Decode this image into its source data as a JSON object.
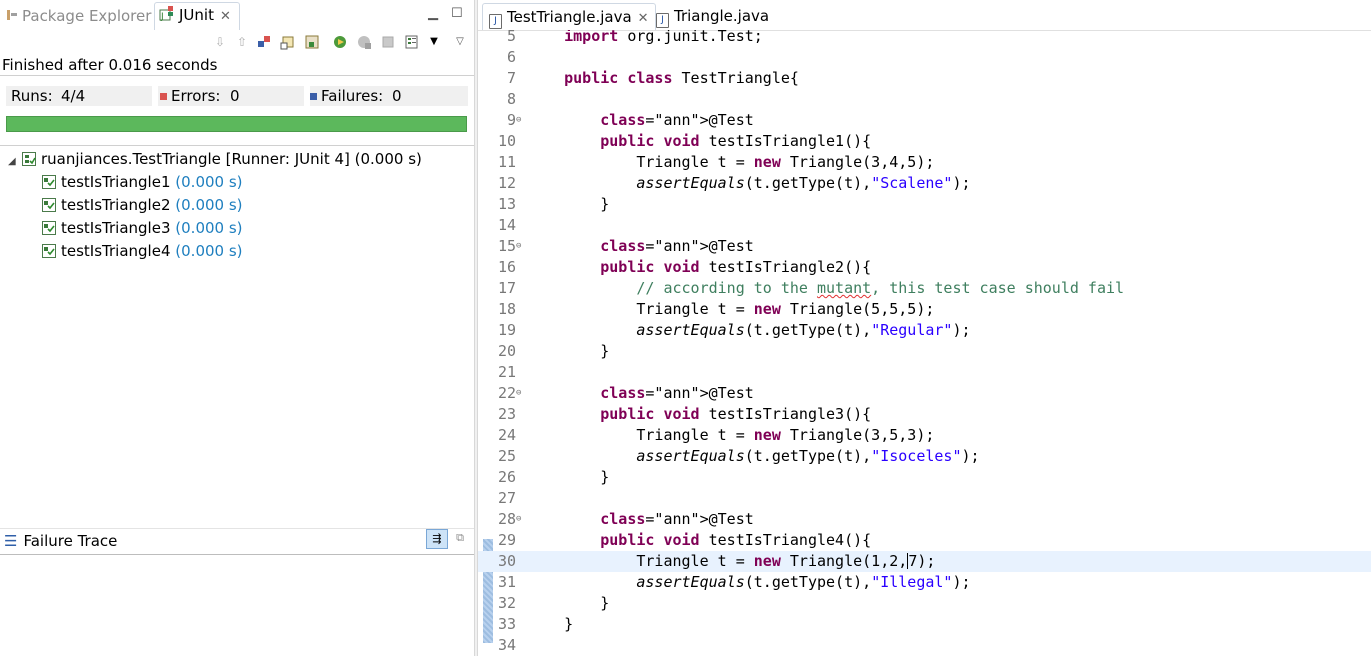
{
  "left_panel": {
    "tabs": {
      "package_explorer": "Package Explorer",
      "junit": "JUnit"
    },
    "toolbar_icons": [
      "next-failure-icon",
      "previous-failure-icon",
      "show-failures-only-icon",
      "scroll-lock-icon",
      "history-icon",
      "rerun-icon",
      "rerun-failed-first-icon",
      "stop-icon",
      "view-menu-icon",
      "dropdown-icon",
      "panel-menu-icon"
    ],
    "status": "Finished after 0.016 seconds",
    "counters": {
      "runs_label": "Runs:",
      "runs_value": "4/4",
      "errors_label": "Errors:",
      "errors_value": "0",
      "failures_label": "Failures:",
      "failures_value": "0"
    },
    "progress": {
      "fraction": 1.0,
      "color": "#5cb85c"
    },
    "tree": {
      "suite": "ruanjiances.TestTriangle [Runner: JUnit 4] (0.000 s)",
      "tests": [
        {
          "name": "testIsTriangle1",
          "time": "(0.000 s)"
        },
        {
          "name": "testIsTriangle2",
          "time": "(0.000 s)"
        },
        {
          "name": "testIsTriangle3",
          "time": "(0.000 s)"
        },
        {
          "name": "testIsTriangle4",
          "time": "(0.000 s)"
        }
      ]
    },
    "failure_trace": {
      "title": "Failure Trace"
    }
  },
  "editor": {
    "tabs": [
      {
        "label": "TestTriangle.java",
        "active": true
      },
      {
        "label": "Triangle.java",
        "active": false
      }
    ],
    "lines": [
      {
        "n": "5",
        "t": "    import org.junit.Test;"
      },
      {
        "n": "6",
        "t": ""
      },
      {
        "n": "7",
        "t": "    public class TestTriangle{"
      },
      {
        "n": "8",
        "t": ""
      },
      {
        "n": "9",
        "t": "        @Test"
      },
      {
        "n": "10",
        "t": "        public void testIsTriangle1(){"
      },
      {
        "n": "11",
        "t": "            Triangle t = new Triangle(3,4,5);"
      },
      {
        "n": "12",
        "t": "            assertEquals(t.getType(t),\"Scalene\");"
      },
      {
        "n": "13",
        "t": "        }"
      },
      {
        "n": "14",
        "t": ""
      },
      {
        "n": "15",
        "t": "        @Test"
      },
      {
        "n": "16",
        "t": "        public void testIsTriangle2(){"
      },
      {
        "n": "17",
        "t": "            // according to the mutant, this test case should fail"
      },
      {
        "n": "18",
        "t": "            Triangle t = new Triangle(5,5,5);"
      },
      {
        "n": "19",
        "t": "            assertEquals(t.getType(t),\"Regular\");"
      },
      {
        "n": "20",
        "t": "        }"
      },
      {
        "n": "21",
        "t": ""
      },
      {
        "n": "22",
        "t": "        @Test"
      },
      {
        "n": "23",
        "t": "        public void testIsTriangle3(){"
      },
      {
        "n": "24",
        "t": "            Triangle t = new Triangle(3,5,3);"
      },
      {
        "n": "25",
        "t": "            assertEquals(t.getType(t),\"Isoceles\");"
      },
      {
        "n": "26",
        "t": "        }"
      },
      {
        "n": "27",
        "t": ""
      },
      {
        "n": "28",
        "t": "        @Test"
      },
      {
        "n": "29",
        "t": "        public void testIsTriangle4(){"
      },
      {
        "n": "30",
        "t": "            Triangle t = new Triangle(1,2,7);"
      },
      {
        "n": "31",
        "t": "            assertEquals(t.getType(t),\"Illegal\");"
      },
      {
        "n": "32",
        "t": "        }"
      },
      {
        "n": "33",
        "t": "    }"
      },
      {
        "n": "34",
        "t": ""
      }
    ],
    "current_line": "30",
    "fold_markers": [
      "9",
      "15",
      "22",
      "28"
    ]
  }
}
